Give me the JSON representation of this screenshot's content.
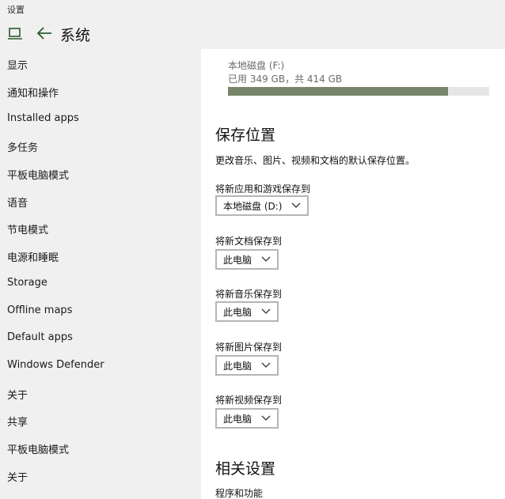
{
  "window": {
    "title": "设置"
  },
  "header": {
    "title": "系统",
    "pc_icon": "laptop-icon",
    "back_icon": "back-arrow-icon"
  },
  "sidebar": {
    "items": [
      {
        "label": "显示"
      },
      {
        "label": "通知和操作"
      },
      {
        "label": "Installed apps"
      },
      {
        "label": "多任务"
      },
      {
        "label": "平板电脑模式"
      },
      {
        "label": "语音"
      },
      {
        "label": "节电模式"
      },
      {
        "label": "电源和睡眠"
      },
      {
        "label": "Storage"
      },
      {
        "label": "Offline maps"
      },
      {
        "label": "Default apps"
      },
      {
        "label": "Windows Defender"
      },
      {
        "label": "关于"
      },
      {
        "label": "共享"
      },
      {
        "label": "平板电脑模式"
      },
      {
        "label": "关于"
      }
    ]
  },
  "drive": {
    "name": "本地磁盘 (F:)",
    "usage": "已用 349 GB，共 414 GB",
    "used_fraction": 0.843,
    "bar_color": "#77866a"
  },
  "save_locations": {
    "title": "保存位置",
    "description": "更改音乐、图片、视频和文档的默认保存位置。",
    "apps": {
      "label": "将新应用和游戏保存到",
      "value": "本地磁盘 (D:)"
    },
    "documents": {
      "label": "将新文档保存到",
      "value": "此电脑"
    },
    "music": {
      "label": "将新音乐保存到",
      "value": "此电脑"
    },
    "pictures": {
      "label": "将新图片保存到",
      "value": "此电脑"
    },
    "videos": {
      "label": "将新视频保存到",
      "value": "此电脑"
    }
  },
  "related": {
    "title": "相关设置",
    "link": "程序和功能"
  }
}
